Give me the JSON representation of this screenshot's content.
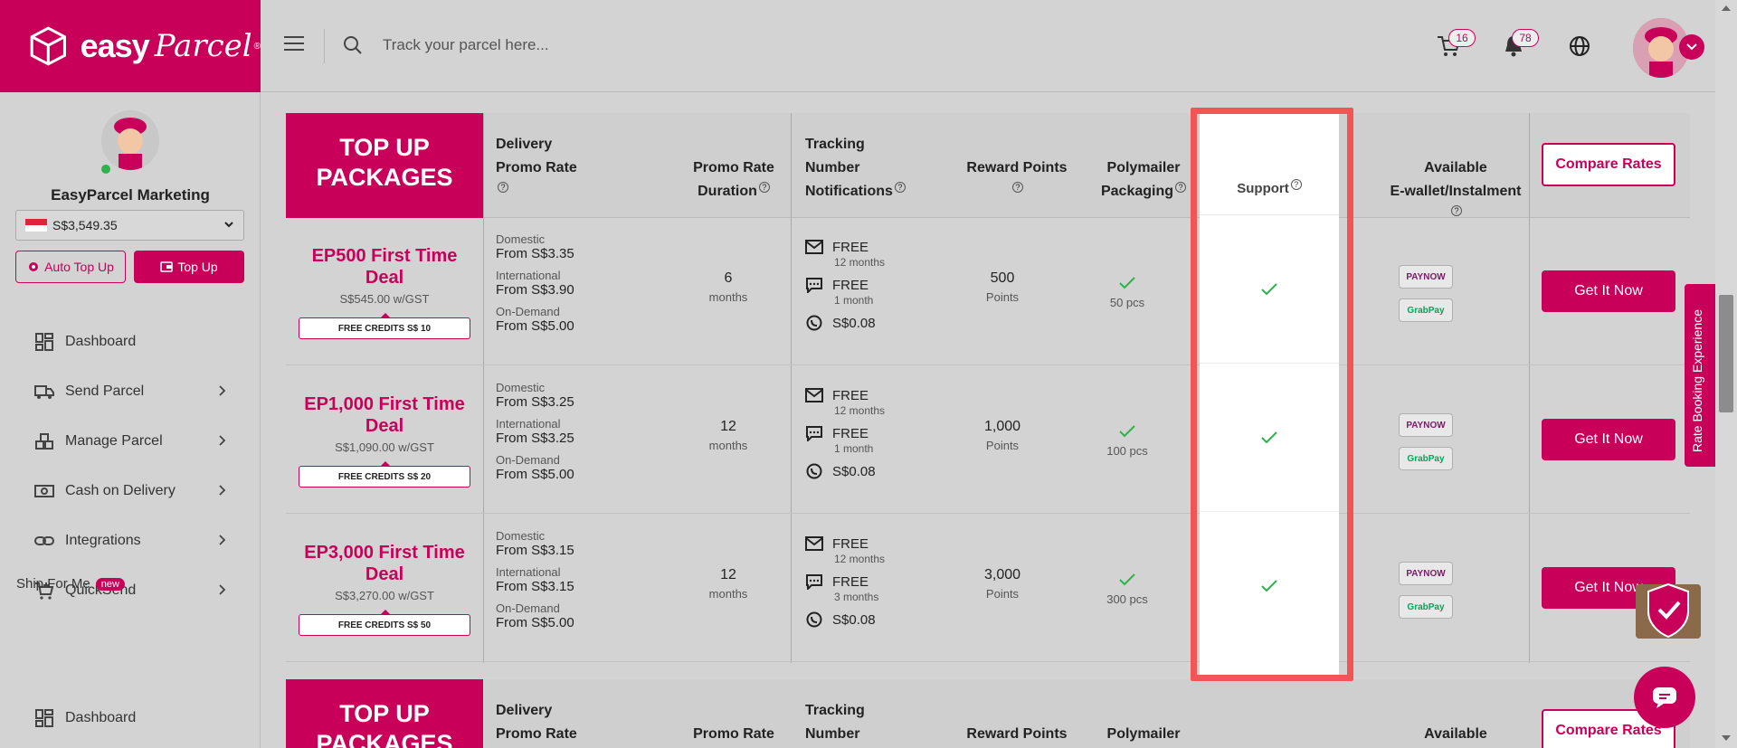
{
  "brand": {
    "name_bold": "easy",
    "name_script": "Parcel",
    "reg": "®"
  },
  "topbar": {
    "search_placeholder": "Track your parcel here...",
    "cart_count": "16",
    "notif_count": "78"
  },
  "sidebar": {
    "user_name": "EasyParcel Marketing",
    "balance": "S$3,549.35",
    "auto_topup": "Auto Top Up",
    "topup": "Top Up",
    "items": [
      {
        "label": "Dashboard",
        "icon": "dashboard-icon"
      },
      {
        "label": "Send Parcel",
        "icon": "truck-icon"
      },
      {
        "label": "Manage Parcel",
        "icon": "boxes-icon"
      },
      {
        "label": "Cash on Delivery",
        "icon": "cash-icon"
      },
      {
        "label": "Integrations",
        "icon": "link-icon"
      },
      {
        "label": "QuickSend",
        "icon": "cart-plus-icon"
      }
    ],
    "ship_for_me": "Ship For Me",
    "new_badge": "new",
    "ship_dashboard": "Dashboard"
  },
  "table": {
    "header": {
      "title_line1": "TOP UP",
      "title_line2": "PACKAGES",
      "delivery_l1": "Delivery",
      "delivery_l2": "Promo Rate",
      "duration_l1": "Promo Rate",
      "duration_l2": "Duration",
      "tracking_l1": "Tracking",
      "tracking_l2": "Number",
      "tracking_l3": "Notifications",
      "reward": "Reward Points",
      "poly_l1": "Polymailer",
      "poly_l2": "Packaging",
      "support": "Support",
      "wallet_l1": "Available",
      "wallet_l2": "E-wallet/Instalment",
      "compare": "Compare Rates"
    },
    "labels": {
      "domestic": "Domestic",
      "international": "International",
      "ondemand": "On-Demand",
      "months": "months",
      "points": "Points",
      "free": "FREE",
      "paynow": "PAYNOW",
      "grabpay": "GrabPay",
      "get": "Get It Now"
    },
    "rows": [
      {
        "name": "EP500 First Time Deal",
        "price": "S$545.00 w/GST",
        "credits": "FREE CREDITS S$ 10",
        "domestic": "From S$3.35",
        "international": "From S$3.90",
        "ondemand": "From S$5.00",
        "duration": "6",
        "email_period": "12 months",
        "sms_period": "1 month",
        "whatsapp": "S$0.08",
        "points": "500",
        "poly": "50 pcs"
      },
      {
        "name": "EP1,000 First Time Deal",
        "price": "S$1,090.00 w/GST",
        "credits": "FREE CREDITS S$ 20",
        "domestic": "From S$3.25",
        "international": "From S$3.25",
        "ondemand": "From S$5.00",
        "duration": "12",
        "email_period": "12 months",
        "sms_period": "1 month",
        "whatsapp": "S$0.08",
        "points": "1,000",
        "poly": "100 pcs"
      },
      {
        "name": "EP3,000 First Time Deal",
        "price": "S$3,270.00 w/GST",
        "credits": "FREE CREDITS S$ 50",
        "domestic": "From S$3.15",
        "international": "From S$3.15",
        "ondemand": "From S$5.00",
        "duration": "12",
        "email_period": "12 months",
        "sms_period": "3 months",
        "whatsapp": "S$0.08",
        "points": "3,000",
        "poly": "300 pcs"
      }
    ]
  },
  "side_tab": "Rate Booking Experience",
  "colors": {
    "brand": "#c8005a",
    "highlight": "#f25555",
    "check": "#2db34a"
  }
}
